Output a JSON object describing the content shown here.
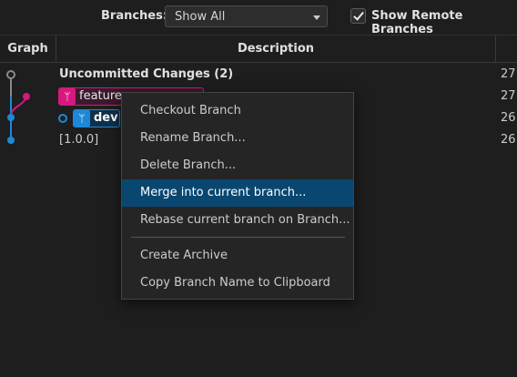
{
  "toolbar": {
    "branches_label": "Branches:",
    "branches_value": "Show All",
    "show_remote_label": "Show Remote Branches",
    "show_remote_checked": true
  },
  "columns": {
    "graph": "Graph",
    "description": "Description",
    "date": ""
  },
  "rows": [
    {
      "text": "Uncommitted Changes (2)",
      "date": "27 ..."
    },
    {
      "branch": "feature-",
      "date": "27 ..."
    },
    {
      "branch": "dev",
      "date": "26 ..."
    },
    {
      "text": "[1.0.0]",
      "date": "26 ..."
    }
  ],
  "context_menu": {
    "items": [
      "Checkout Branch",
      "Rename Branch...",
      "Delete Branch...",
      "Merge into current branch...",
      "Rebase current branch on Branch...",
      "Create Archive",
      "Copy Branch Name to Clipboard"
    ],
    "highlighted": "Merge into current branch..."
  },
  "colors": {
    "feature_branch": "#d6187f",
    "dev_branch": "#1e88d8",
    "highlight": "#094771",
    "uncommitted_node": "#8a8a8a"
  },
  "icons": {
    "branch": "branch-icon",
    "dropdown": "chevron-down-icon",
    "check": "check-icon"
  }
}
